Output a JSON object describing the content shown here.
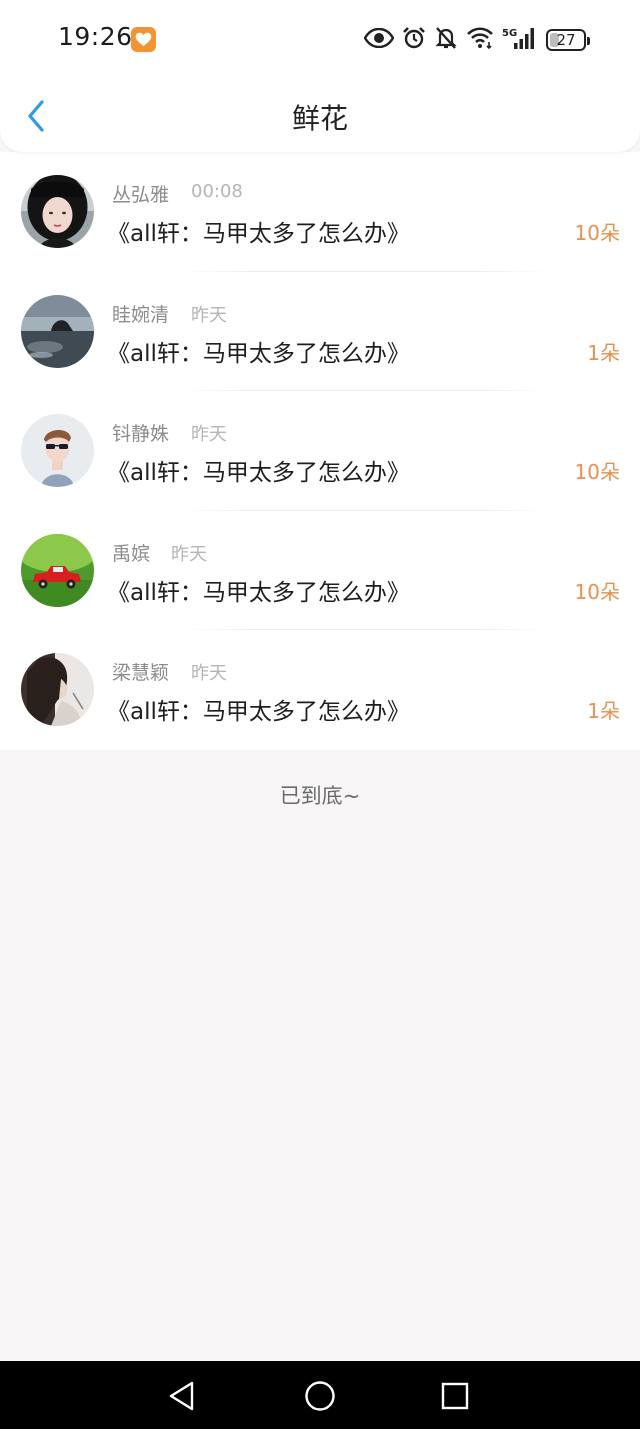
{
  "status_bar": {
    "time": "19:26",
    "battery": "27",
    "icons": [
      "eye-icon",
      "alarm-icon",
      "bell-off-icon",
      "wifi-icon",
      "signal-5g-icon",
      "battery-icon"
    ]
  },
  "header": {
    "title": "鲜花",
    "back_icon": "chevron-left-icon"
  },
  "list": [
    {
      "name": "丛弘雅",
      "time": "00:08",
      "book": "《all轩：马甲太多了怎么办》",
      "count": "10朵",
      "avatar": "girl-portrait"
    },
    {
      "name": "眭婉清",
      "time": "昨天",
      "book": "《all轩：马甲太多了怎么办》",
      "count": "1朵",
      "avatar": "seaside-rock"
    },
    {
      "name": "钭静姝",
      "time": "昨天",
      "book": "《all轩：马甲太多了怎么办》",
      "count": "10朵",
      "avatar": "boy-sunglasses"
    },
    {
      "name": "禹嫔",
      "time": "昨天",
      "book": "《all轩：马甲太多了怎么办》",
      "count": "10朵",
      "avatar": "red-toy-car"
    },
    {
      "name": "梁慧颖",
      "time": "昨天",
      "book": "《all轩：马甲太多了怎么办》",
      "count": "1朵",
      "avatar": "woman-profile"
    }
  ],
  "footer": {
    "end_text": "已到底~"
  },
  "nav_bar": {
    "buttons": [
      "back-triangle-icon",
      "home-circle-icon",
      "recents-square-icon"
    ]
  },
  "colors": {
    "accent_blue": "#2d9ae8",
    "count_orange": "#e8914f",
    "badge_orange": "#f39332"
  }
}
